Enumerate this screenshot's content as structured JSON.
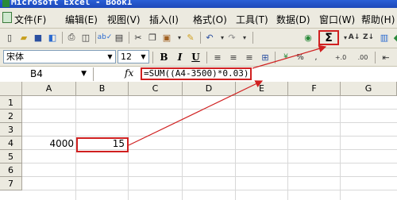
{
  "window": {
    "title": "Microsoft Excel - Book1"
  },
  "menu": {
    "items": [
      "文件(F)",
      "编辑(E)",
      "视图(V)",
      "插入(I)",
      "格式(O)",
      "工具(T)",
      "数据(D)",
      "窗口(W)",
      "帮助(H)"
    ]
  },
  "toolbar": {
    "sigma_label": "Σ",
    "icons": [
      "new-icon",
      "open-icon",
      "save-icon",
      "permission-icon",
      "print-icon",
      "print-preview-icon",
      "spelling-icon",
      "research-icon",
      "cut-icon",
      "copy-icon",
      "paste-icon",
      "format-painter-icon",
      "undo-icon",
      "redo-icon",
      "hyperlink-icon",
      "autosum-icon",
      "sort-ascending-icon",
      "sort-descending-icon",
      "chart-wizard-icon",
      "drawing-icon"
    ]
  },
  "format": {
    "font": "宋体",
    "size": "12",
    "bold": "B",
    "italic": "I",
    "underline": "U",
    "increase_decimal": "+.0",
    "decrease_decimal": ".00"
  },
  "formula_bar": {
    "name_box": "B4",
    "fx": "fx",
    "formula": "=SUM((A4-3500)*0.03)"
  },
  "sheet": {
    "columns": [
      "A",
      "B",
      "C",
      "D",
      "E",
      "F",
      "G"
    ],
    "rows": [
      "1",
      "2",
      "3",
      "4",
      "5",
      "6",
      "7"
    ],
    "cells": {
      "A4": "4000",
      "B4": "15"
    }
  },
  "colors": {
    "annotation": "#d02020",
    "chrome": "#eceae0",
    "title": "#2a5fd6"
  }
}
